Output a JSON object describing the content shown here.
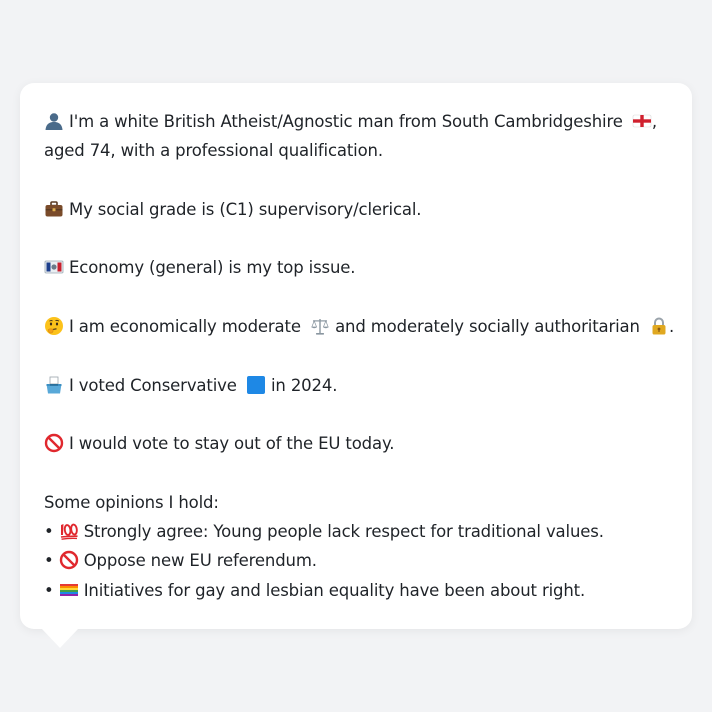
{
  "profile": {
    "identity_line1": "I'm a white British Atheist/Agnostic man from South Cambridgeshire",
    "identity_line1_end": ",",
    "identity_line2": "aged 74, with a professional qualification.",
    "social_grade": "My social grade is (C1) supervisory/clerical.",
    "top_issue": "Economy (general) is my top issue.",
    "ideology_part1": "I am economically moderate",
    "ideology_part2": "and moderately socially authoritarian",
    "ideology_end": ".",
    "vote_part1": "I voted Conservative",
    "vote_part2": "in 2024.",
    "eu_stance": "I would vote to stay out of the EU today."
  },
  "opinions": {
    "heading": "Some opinions I hold:",
    "bullet": "•",
    "items": [
      {
        "icon": "hundred-points-icon",
        "text": "Strongly agree: Young people lack respect for traditional values."
      },
      {
        "icon": "prohibited-icon",
        "text": "Oppose new EU referendum."
      },
      {
        "icon": "rainbow-flag-icon",
        "text": "Initiatives for gay and lesbian equality have been about right."
      }
    ]
  },
  "icons": {
    "person": "bust-in-silhouette-icon",
    "flag": "england-flag-icon",
    "briefcase": "briefcase-icon",
    "economy": "banknote-icon",
    "thinking": "thinking-face-icon",
    "scales": "balance-scale-icon",
    "lock": "lock-icon",
    "ballot": "ballot-box-icon",
    "party": "blue-square-icon",
    "eu": "prohibited-icon"
  },
  "colors": {
    "background": "#f2f3f5",
    "card": "#ffffff",
    "text": "#1f2328",
    "conservative_blue": "#1e88e5"
  }
}
